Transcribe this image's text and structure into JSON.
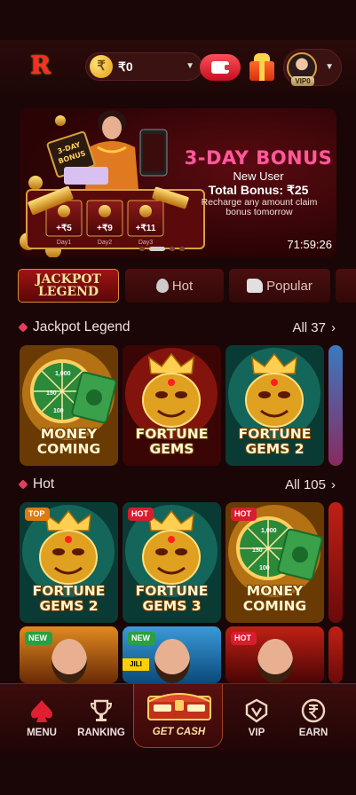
{
  "header": {
    "balance": "₹0",
    "coin_symbol": "₹",
    "vip_label": "VIP0"
  },
  "banner": {
    "art_labels": {
      "box_top": "3-DAY",
      "box_bottom": "BONUS"
    },
    "title": "3-DAY BONUS",
    "line1": "New User",
    "line2": "Total Bonus: ₹25",
    "line3": "Recharge any amount claim bonus tomorrow",
    "countdown": "71:59:26",
    "days": [
      {
        "amount": "+₹5",
        "label": "Day1"
      },
      {
        "amount": "+₹9",
        "label": "Day2"
      },
      {
        "amount": "+₹11",
        "label": "Day3"
      }
    ],
    "carousel_pages": 4,
    "active_page": 1
  },
  "tabs": {
    "jackpot_line1": "JACKPOT",
    "jackpot_line2": "LEGEND",
    "hot": "Hot",
    "popular": "Popular"
  },
  "sections": {
    "jackpot": {
      "title": "Jackpot Legend",
      "see_all": "All 37"
    },
    "hot": {
      "title": "Hot",
      "see_all": "All 105"
    }
  },
  "jackpot_games": [
    {
      "line1": "MONEY",
      "line2": "COMING"
    },
    {
      "line1": "FORTUNE",
      "line2": "GEMS"
    },
    {
      "line1": "FORTUNE",
      "line2": "GEMS 2"
    }
  ],
  "hot_games": [
    {
      "tag": "TOP",
      "line1": "FORTUNE",
      "line2": "GEMS 2"
    },
    {
      "tag": "HOT",
      "line1": "FORTUNE",
      "line2": "GEMS 3"
    },
    {
      "tag": "HOT",
      "line1": "MONEY",
      "line2": "COMING"
    }
  ],
  "more_games": [
    {
      "tag": "NEW",
      "sign": ""
    },
    {
      "tag": "NEW",
      "sign": "JILI"
    },
    {
      "tag": "HOT",
      "sign": ""
    }
  ],
  "wheel_numbers": [
    "1,000",
    "150",
    "100"
  ],
  "bottom_nav": {
    "menu": "MENU",
    "ranking": "RANKING",
    "get_cash": "GET CASH",
    "vip": "VIP",
    "earn": "EARN"
  },
  "colors": {
    "background": "#1a0606",
    "accent_red": "#d81e2e",
    "gold": "#e0a020",
    "banner_title": "#ff5a9a"
  }
}
